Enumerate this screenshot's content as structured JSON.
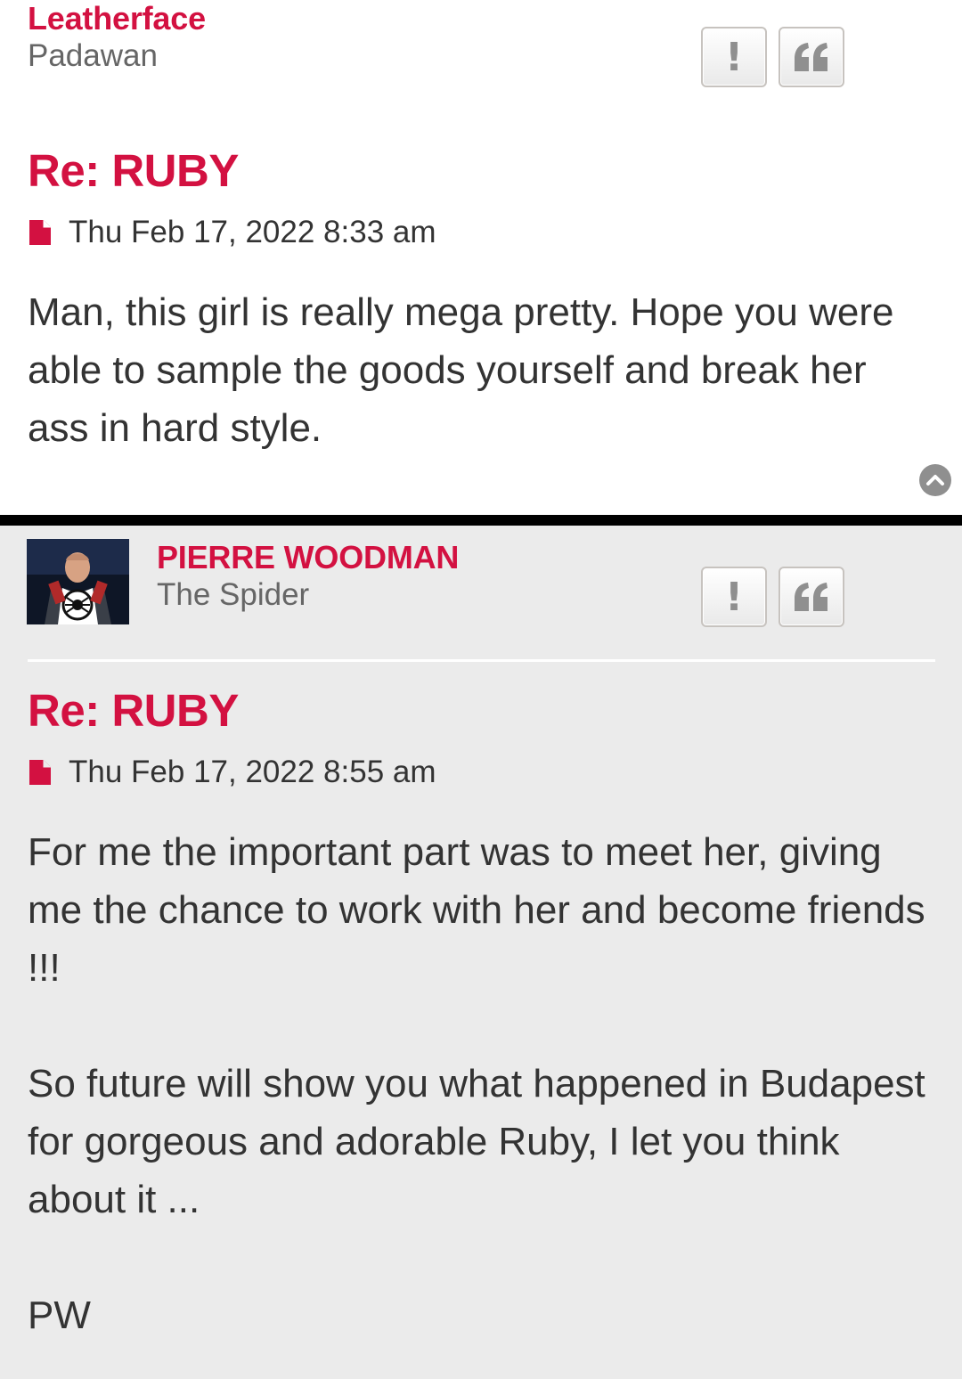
{
  "posts": [
    {
      "author": "Leatherface",
      "rank": "Padawan",
      "title": "Re: RUBY",
      "date": "Thu Feb 17, 2022 8:33 am",
      "content": [
        "Man, this girl is really mega pretty. Hope you were able to sample the goods yourself and break her ass in hard style."
      ],
      "buttons": {
        "report": "!",
        "quote": "quote-icon"
      }
    },
    {
      "author": "PIERRE WOODMAN",
      "rank": "The Spider",
      "title": "Re: RUBY",
      "date": "Thu Feb 17, 2022 8:55 am",
      "content": [
        "For me the important part was to meet her, giving me the chance to work with her and become friends !!!",
        "So future will show you what happened in Budapest for gorgeous and adorable Ruby, I let you think about it ...",
        "PW"
      ],
      "buttons": {
        "report": "!",
        "quote": "quote-icon"
      }
    }
  ],
  "icons": {
    "post_icon": "file-icon",
    "back_to_top": "chevron-up-circle-icon"
  },
  "colors": {
    "accent": "#d31141",
    "text": "#333333",
    "rank": "#666666",
    "post_bg_alt": "#ebebeb",
    "button_icon": "#8f8f8f"
  }
}
